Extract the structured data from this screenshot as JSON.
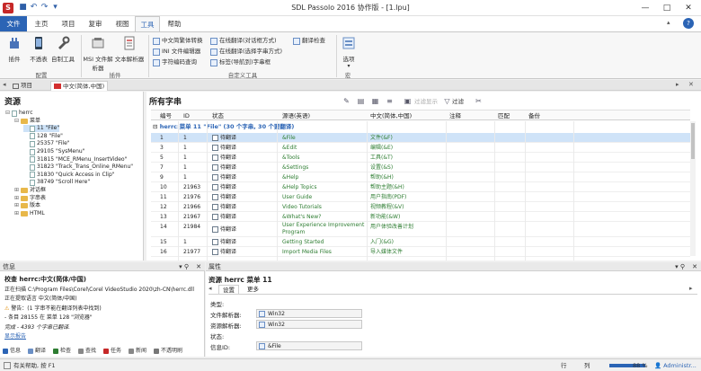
{
  "window": {
    "title": "SDL Passolo 2016 协作版 - [1.lpu]",
    "controls": [
      "—",
      "□",
      "✕"
    ]
  },
  "ribbon_tabs": [
    "文件",
    "主页",
    "项目",
    "复审",
    "视图",
    "工具",
    "帮助"
  ],
  "ribbon": {
    "buttons": {
      "plugins": "插件",
      "untranslatable": "不透表",
      "custom_tools": "自制工具",
      "msi": "MSI 文件解析器",
      "text_parser": "文本解析器",
      "options": "选项"
    },
    "small_commands": [
      "中文简繁体转换",
      "INI 文件编辑器",
      "字符编码查询",
      "在线翻译(对话框方式)",
      "在线翻译(选择字串方式)",
      "标签(导航到)字串框",
      "翻译检查"
    ],
    "groups": [
      "配置",
      "插件",
      "自定义工具",
      "宏"
    ]
  },
  "doc_tabs": [
    "项目",
    "中文(简体,中国)"
  ],
  "left_panel": {
    "title": "资源",
    "tree": [
      {
        "label": "herrc",
        "level": 0,
        "kind": "doc"
      },
      {
        "label": "菜单",
        "level": 1,
        "kind": "folder"
      },
      {
        "label": "11 \"File\"",
        "level": 2,
        "kind": "doc",
        "selected": true
      },
      {
        "label": "128 \"File\"",
        "level": 2,
        "kind": "doc"
      },
      {
        "label": "25357 \"File\"",
        "level": 2,
        "kind": "doc"
      },
      {
        "label": "29105 \"SysMenu\"",
        "level": 2,
        "kind": "doc"
      },
      {
        "label": "31815 \"MCE_RMenu_InsertVideo\"",
        "level": 2,
        "kind": "doc"
      },
      {
        "label": "31823 \"Track_Trans_Online_RMenu\"",
        "level": 2,
        "kind": "doc"
      },
      {
        "label": "31830 \"Quick Access in Clip\"",
        "level": 2,
        "kind": "doc"
      },
      {
        "label": "38749 \"Scroll Here\"",
        "level": 2,
        "kind": "doc"
      },
      {
        "label": "对话框",
        "level": 1,
        "kind": "folder"
      },
      {
        "label": "字串表",
        "level": 1,
        "kind": "folder"
      },
      {
        "label": "版本",
        "level": 1,
        "kind": "folder"
      },
      {
        "label": "HTML",
        "level": 1,
        "kind": "folder"
      }
    ]
  },
  "main_panel": {
    "title": "所有字串",
    "toolbar": {
      "filter_display": "过滤显示",
      "filter": "过滤"
    },
    "columns": [
      "编号",
      "ID",
      "状态",
      "源语(英语)",
      "中文(简体,中国)",
      "注释",
      "匹配",
      "备份"
    ],
    "group_header": "herrc:菜单 11 \"File\" (30 个字串, 30 个要翻译)",
    "rows": [
      {
        "num": "1",
        "id": "1",
        "status": "待翻译",
        "source": "&File",
        "target": "文件(&F)",
        "selected": true
      },
      {
        "num": "3",
        "id": "1",
        "status": "待翻译",
        "source": "&Edit",
        "target": "编辑(&E)"
      },
      {
        "num": "5",
        "id": "1",
        "status": "待翻译",
        "source": "&Tools",
        "target": "工具(&T)"
      },
      {
        "num": "7",
        "id": "1",
        "status": "待翻译",
        "source": "&Settings",
        "target": "设置(&S)"
      },
      {
        "num": "9",
        "id": "1",
        "status": "待翻译",
        "source": "&Help",
        "target": "帮助(&H)"
      },
      {
        "num": "10",
        "id": "21963",
        "status": "待翻译",
        "source": "&Help Topics",
        "target": "帮助主题(&H)"
      },
      {
        "num": "11",
        "id": "21976",
        "status": "待翻译",
        "source": "User Guide",
        "target": "用户指南(PDF)"
      },
      {
        "num": "12",
        "id": "21966",
        "status": "待翻译",
        "source": "Video Tutorials",
        "target": "视频教程(&V)"
      },
      {
        "num": "13",
        "id": "21967",
        "status": "待翻译",
        "source": "&What's New?",
        "target": "新功能(&W)"
      },
      {
        "num": "14",
        "id": "21984",
        "status": "待翻译",
        "source": "User Experience Improvement Program",
        "target": "用户体验改善计划",
        "tall": true
      },
      {
        "num": "15",
        "id": "1",
        "status": "待翻译",
        "source": "Getting Started",
        "target": "入门(&G)"
      },
      {
        "num": "16",
        "id": "21977",
        "status": "待翻译",
        "source": "Import Media Files",
        "target": "导入媒体文件"
      }
    ]
  },
  "info_panel": {
    "title": "信息",
    "lines": [
      {
        "text": "校查 herrc:中文(简体/中国)",
        "style": "bold"
      },
      {
        "text": "正在扫描 C:\\Program Files\\Corel\\Corel VideoStudio 2020\\zh-CN\\herrc.dll",
        "style": ""
      },
      {
        "text": "正在提取语言 中文(简体/中国)",
        "style": ""
      },
      {
        "text": "警告：(1 字串不能在翻译列表中找到)",
        "style": "warn"
      },
      {
        "text": "- 条目 28155 在 菜单 128 \"浏览器\"",
        "style": ""
      },
      {
        "text": "完成 - 4393 个字串已翻译.",
        "style": "italic"
      },
      {
        "text": "显示报告",
        "style": "link"
      }
    ],
    "tabs": [
      "信息",
      "翻译",
      "检查",
      "查找",
      "任务",
      "新闻",
      "不透明刷"
    ]
  },
  "props_panel": {
    "title": "属性",
    "subtitle": "资源 herrc 菜单 11",
    "tabs": [
      "设置",
      "更多"
    ],
    "fields": [
      {
        "label": "类型:",
        "value": ""
      },
      {
        "label": "文件解析器:",
        "value": "Win32"
      },
      {
        "label": "资源解析器:",
        "value": "Win32"
      },
      {
        "label": "状态:",
        "value": ""
      },
      {
        "label": "信息ID:",
        "value": "&File"
      }
    ]
  },
  "status_bar": {
    "left": "有关帮助, 按 F1",
    "row_label": "行",
    "col_label": "列",
    "zoom": "88 %",
    "user": "Administr..."
  },
  "colors": {
    "accent": "#2b64b5",
    "selection": "#cfe3f8",
    "brand_red": "#c62828",
    "target_text": "#2e7d32"
  }
}
